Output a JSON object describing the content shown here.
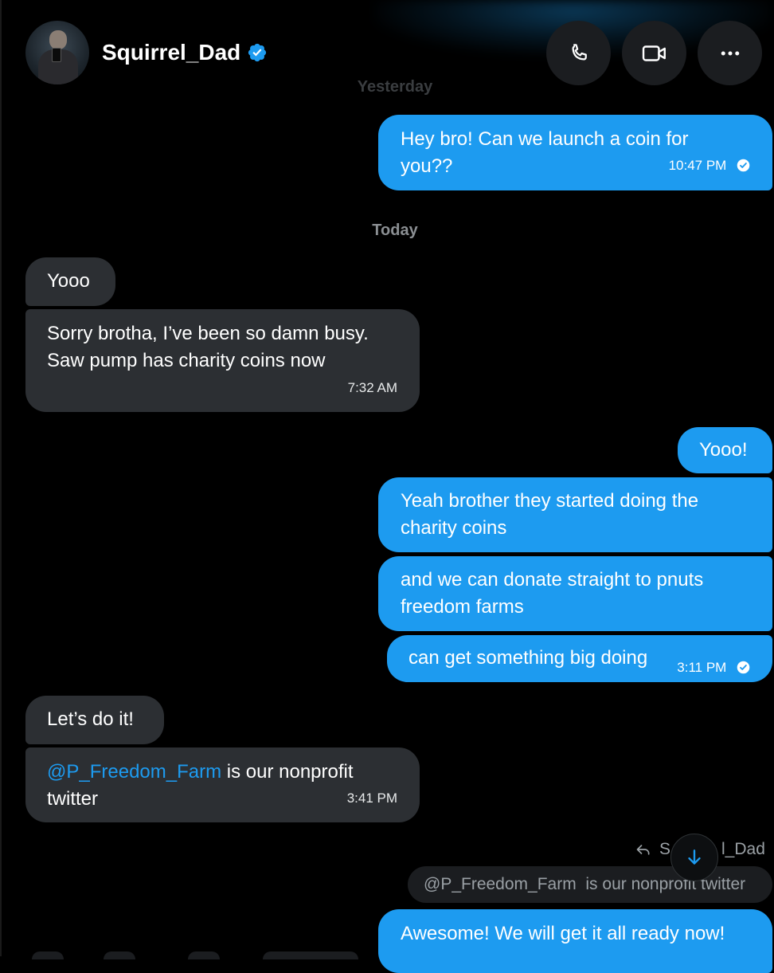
{
  "contact": {
    "name": "Squirrel_Dad",
    "verified": true
  },
  "header_actions": {
    "call": "phone-icon",
    "video": "video-icon",
    "more": "more-icon"
  },
  "separators": {
    "yesterday": "Yesterday",
    "today": "Today"
  },
  "messages": [
    {
      "dir": "out",
      "text": "Hey bro! Can we launch a coin for you??",
      "time": "10:47 PM",
      "read": true
    },
    {
      "dir": "in",
      "text": "Yooo"
    },
    {
      "dir": "in",
      "text_line1": "Sorry brotha, I’ve been so damn busy.",
      "text_line2": "Saw pump has charity coins now",
      "time": "7:32 AM"
    },
    {
      "dir": "out",
      "text": "Yooo!"
    },
    {
      "dir": "out",
      "text": "Yeah brother they started doing the charity coins"
    },
    {
      "dir": "out",
      "text": "and we can donate straight to pnuts freedom farms"
    },
    {
      "dir": "out",
      "text": "can get something big doing",
      "time": "3:11 PM",
      "read": true
    },
    {
      "dir": "in",
      "text": "Let’s do it!"
    },
    {
      "dir": "in",
      "mention": "@P_Freedom_Farm",
      "text": " is our nonprofit twitter",
      "time": "3:41 PM"
    },
    {
      "dir": "out",
      "text": "Awesome! We will get it all ready now!"
    }
  ],
  "reply_context": {
    "replying_to_visible_start": "S",
    "replying_to_visible_end": "l_Dad",
    "quoted_mention": "@P_Freedom_Farm",
    "quoted_text": "  is our nonprofit twitter"
  },
  "colors": {
    "accent": "#1d9bf0",
    "incoming_bubble": "#2c2f33",
    "background": "#000000"
  }
}
